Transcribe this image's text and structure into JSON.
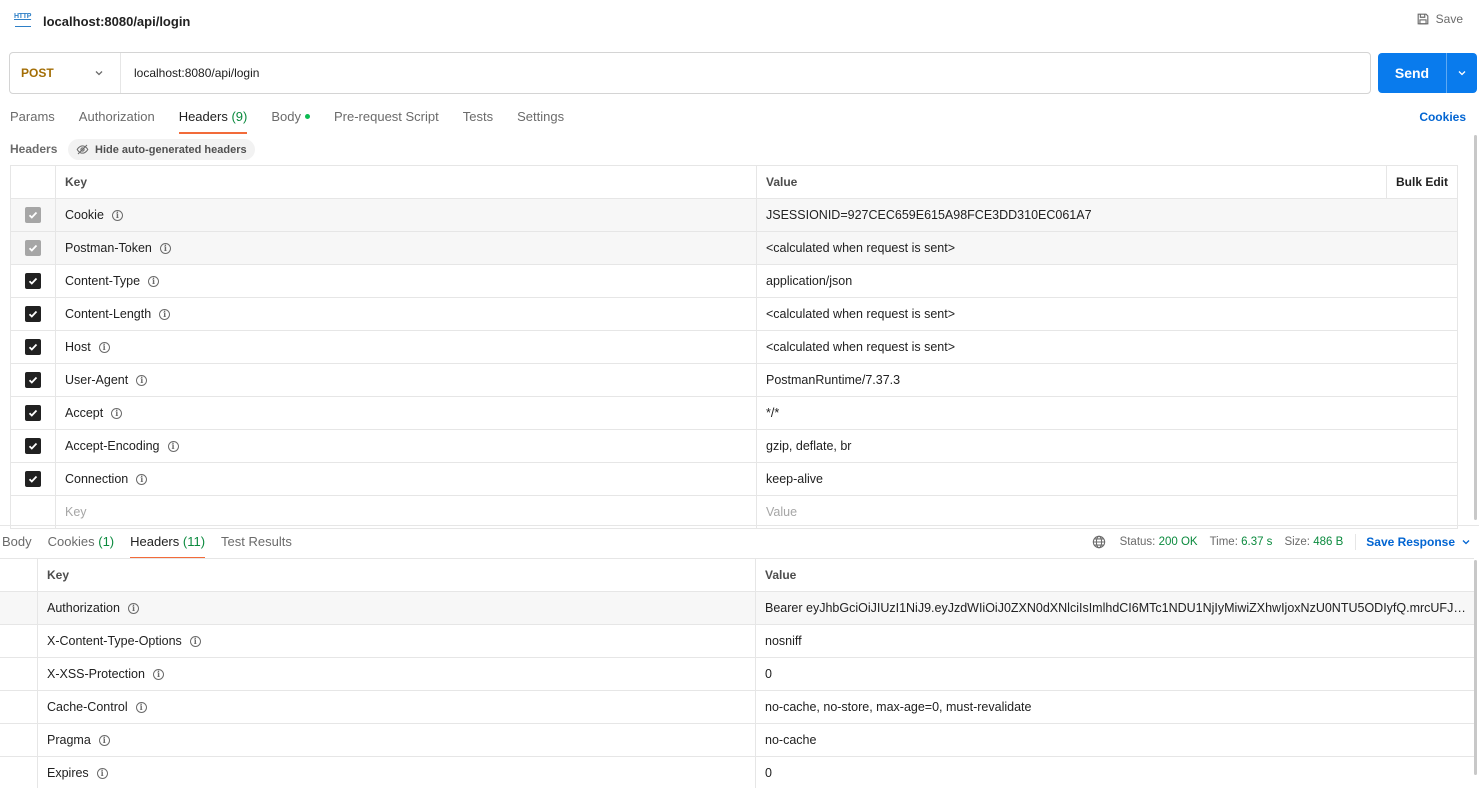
{
  "titlebar": {
    "title": "localhost:8080/api/login",
    "save_label": "Save",
    "icon": "http-icon"
  },
  "request": {
    "method": "POST",
    "url": "localhost:8080/api/login",
    "send_label": "Send"
  },
  "request_tabs": [
    {
      "label": "Params"
    },
    {
      "label": "Authorization"
    },
    {
      "label": "Headers",
      "count": "(9)",
      "active": true
    },
    {
      "label": "Body",
      "dot": true
    },
    {
      "label": "Pre-request Script"
    },
    {
      "label": "Tests"
    },
    {
      "label": "Settings"
    }
  ],
  "cookies_link": "Cookies",
  "headers_section": {
    "label": "Headers",
    "hide_auto_label": "Hide auto-generated headers"
  },
  "req_table": {
    "key_header": "Key",
    "value_header": "Value",
    "bulk_edit": "Bulk Edit",
    "rows": [
      {
        "key": "Cookie",
        "value": "JSESSIONID=927CEC659E615A98FCE3DD310EC061A7",
        "state": "disabled"
      },
      {
        "key": "Postman-Token",
        "value": "<calculated when request is sent>",
        "state": "disabled"
      },
      {
        "key": "Content-Type",
        "value": "application/json",
        "state": "checked"
      },
      {
        "key": "Content-Length",
        "value": "<calculated when request is sent>",
        "state": "checked"
      },
      {
        "key": "Host",
        "value": "<calculated when request is sent>",
        "state": "checked"
      },
      {
        "key": "User-Agent",
        "value": "PostmanRuntime/7.37.3",
        "state": "checked"
      },
      {
        "key": "Accept",
        "value": "*/*",
        "state": "checked"
      },
      {
        "key": "Accept-Encoding",
        "value": "gzip, deflate, br",
        "state": "checked"
      },
      {
        "key": "Connection",
        "value": "keep-alive",
        "state": "checked"
      }
    ],
    "new_key_placeholder": "Key",
    "new_value_placeholder": "Value"
  },
  "response_tabs": [
    {
      "label": "Body"
    },
    {
      "label": "Cookies",
      "count": "(1)"
    },
    {
      "label": "Headers",
      "count": "(11)",
      "active": true
    },
    {
      "label": "Test Results"
    }
  ],
  "response_status": {
    "status_label": "Status:",
    "status_value": "200 OK",
    "time_label": "Time:",
    "time_value": "6.37 s",
    "size_label": "Size:",
    "size_value": "486 B",
    "save_response": "Save Response"
  },
  "resp_table": {
    "key_header": "Key",
    "value_header": "Value",
    "rows": [
      {
        "key": "Authorization",
        "value": "Bearer eyJhbGciOiJIUzI1NiJ9.eyJzdWIiOiJ0ZXN0dXNlciIsImlhdCI6MTc1NDU1NjIyMiwiZXhwIjoxNzU0NTU5ODIyfQ.mrcUFJl..."
      },
      {
        "key": "X-Content-Type-Options",
        "value": "nosniff"
      },
      {
        "key": "X-XSS-Protection",
        "value": "0"
      },
      {
        "key": "Cache-Control",
        "value": "no-cache, no-store, max-age=0, must-revalidate"
      },
      {
        "key": "Pragma",
        "value": "no-cache"
      },
      {
        "key": "Expires",
        "value": "0"
      }
    ]
  },
  "colors": {
    "accent": "#f26b3a",
    "send": "#097bed",
    "method": "#a36e06",
    "link": "#0265d2",
    "success": "#0b8a3e"
  }
}
